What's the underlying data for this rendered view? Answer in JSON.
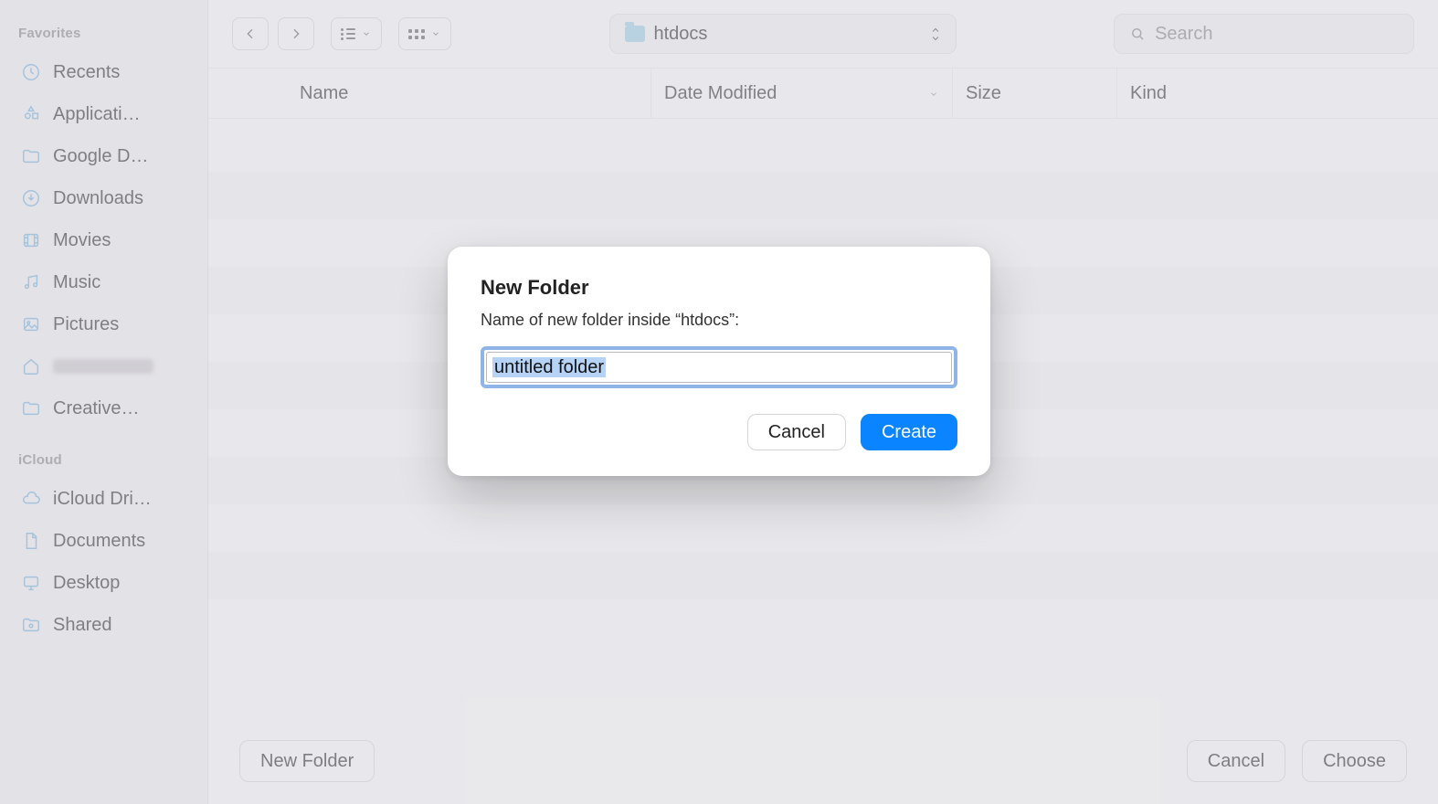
{
  "sidebar": {
    "favorites_label": "Favorites",
    "items": [
      {
        "label": "Recents",
        "icon": "clock"
      },
      {
        "label": "Applicati…",
        "icon": "apps"
      },
      {
        "label": "Google D…",
        "icon": "folder"
      },
      {
        "label": "Downloads",
        "icon": "download"
      },
      {
        "label": "Movies",
        "icon": "film"
      },
      {
        "label": "Music",
        "icon": "music"
      },
      {
        "label": "Pictures",
        "icon": "image"
      },
      {
        "label": "",
        "icon": "home",
        "redacted": true
      },
      {
        "label": "Creative…",
        "icon": "folder"
      }
    ],
    "icloud_label": "iCloud",
    "icloud_items": [
      {
        "label": "iCloud Dri…",
        "icon": "cloud"
      },
      {
        "label": "Documents",
        "icon": "doc"
      },
      {
        "label": "Desktop",
        "icon": "desktop"
      },
      {
        "label": "Shared",
        "icon": "shared"
      }
    ]
  },
  "toolbar": {
    "path_name": "htdocs",
    "search_placeholder": "Search"
  },
  "columns": {
    "name": "Name",
    "date_modified": "Date Modified",
    "size": "Size",
    "kind": "Kind"
  },
  "footer": {
    "new_folder": "New Folder",
    "cancel": "Cancel",
    "choose": "Choose"
  },
  "modal": {
    "title": "New Folder",
    "subtitle": "Name of new folder inside “htdocs”:",
    "input_value": "untitled folder",
    "cancel": "Cancel",
    "create": "Create"
  }
}
